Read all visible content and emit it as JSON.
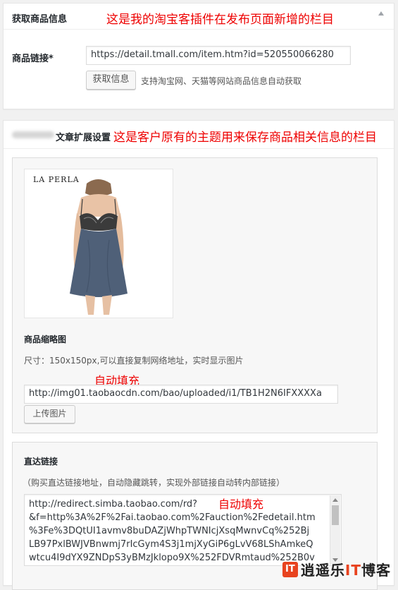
{
  "panel1": {
    "title": "获取商品信息",
    "note": "这是我的淘宝客插件在发布页面新增的栏目",
    "toggle_icon": "triangle-up-icon",
    "product_link_label": "商品链接*",
    "product_link_value": "https://detail.tmall.com/item.htm?id=520550066280",
    "fetch_button": "获取信息",
    "fetch_desc": "支持淘宝网、天猫等网站商品信息自动获取"
  },
  "panel2": {
    "title": "文章扩展设置",
    "note": "这是客户原有的主题用来保存商品相关信息的栏目",
    "thumbnail": {
      "brand_text": "LA PERLA",
      "label": "商品缩略图",
      "desc": "尺寸：150x150px,可以直接复制网络地址，实时显示图片",
      "autofill_note": "自动填充",
      "url_value": "http://img01.taobaocdn.com/bao/uploaded/i1/TB1H2N6IFXXXXa",
      "upload_button": "上传图片"
    },
    "direct_link": {
      "label": "直达链接",
      "desc": "（购买直达链接地址，自动隐藏跳转，实现外部链接自动转内部链接）",
      "autofill_note": "自动填充",
      "lines": [
        "http://redirect.simba.taobao.com/rd?",
        "&f=http%3A%2F%2Fai.taobao.com%2Fauction%2Fedetail.htm",
        "%3Fe%3DQtUI1avmv8buDAZjWhpTWNIcjXsqMwnvCq%252Bj",
        "LB97PxlBWJVBnwmj7rIcGym4S3j1mjXyGiP6gLvV68LShAmkeQ",
        "wtcu4I9dYX9ZNDpS3yBMzJklopo9X%252FDVRmtaud%252B0v"
      ]
    }
  },
  "watermark": {
    "logo": "IT",
    "text_a": "逍遥乐",
    "text_b": "IT",
    "text_c": "博客"
  },
  "colors": {
    "note_red": "#e00000",
    "accent": "#e8431f"
  }
}
